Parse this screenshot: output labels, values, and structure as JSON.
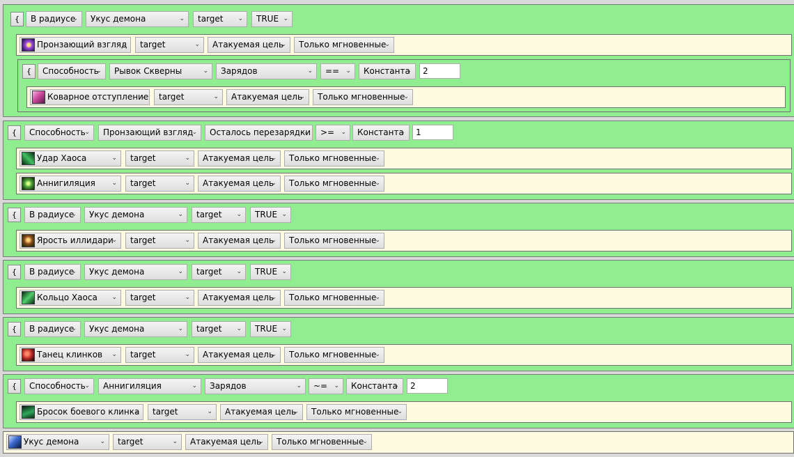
{
  "blocks": [
    {
      "brace": "{",
      "cond": [
        "В радиусе",
        "Укус демона",
        "target",
        "TRUE"
      ],
      "actions": [
        {
          "spell": "Пронзающий взгляд",
          "icon": "eye-beam-icon",
          "target": "target",
          "unit": "Атакуемая цель",
          "mode": "Только мгновенные"
        }
      ],
      "sub": {
        "brace": "{",
        "cond": [
          "Способность",
          "Рывок Скверны",
          "Зарядов",
          "==",
          "Константа"
        ],
        "value": "2",
        "action": {
          "spell": "Коварное отступление",
          "icon": "vengeful-retreat-icon",
          "target": "target",
          "unit": "Атакуемая цель",
          "mode": "Только мгновенные"
        }
      }
    },
    {
      "brace": "{",
      "cond": [
        "Способность",
        "Пронзающий взгляд",
        "Осталось перезарядки",
        ">=",
        "Константа"
      ],
      "value": "1",
      "actions": [
        {
          "spell": "Удар Хаоса",
          "icon": "chaos-strike-icon",
          "target": "target",
          "unit": "Атакуемая цель",
          "mode": "Только мгновенные"
        },
        {
          "spell": "Аннигиляция",
          "icon": "annihilation-icon",
          "target": "target",
          "unit": "Атакуемая цель",
          "mode": "Только мгновенные"
        }
      ]
    },
    {
      "brace": "{",
      "cond": [
        "В радиусе",
        "Укус демона",
        "target",
        "TRUE"
      ],
      "actions": [
        {
          "spell": "Ярость иллидари",
          "icon": "fury-of-the-illidari-icon",
          "target": "target",
          "unit": "Атакуемая цель",
          "mode": "Только мгновенные"
        }
      ]
    },
    {
      "brace": "{",
      "cond": [
        "В радиусе",
        "Укус демона",
        "target",
        "TRUE"
      ],
      "actions": [
        {
          "spell": "Кольцо Хаоса",
          "icon": "chaos-nova-icon",
          "target": "target",
          "unit": "Атакуемая цель",
          "mode": "Только мгновенные"
        }
      ]
    },
    {
      "brace": "{",
      "cond": [
        "В радиусе",
        "Укус демона",
        "target",
        "TRUE"
      ],
      "actions": [
        {
          "spell": "Танец клинков",
          "icon": "blade-dance-icon",
          "target": "target",
          "unit": "Атакуемая цель",
          "mode": "Только мгновенные"
        }
      ]
    },
    {
      "brace": "{",
      "cond": [
        "Способность",
        "Аннигиляция",
        "Зарядов",
        "~=",
        "Константа"
      ],
      "value": "2",
      "actions": [
        {
          "spell": "Бросок боевого клинка",
          "icon": "throw-glaive-icon",
          "target": "target",
          "unit": "Атакуемая цель",
          "mode": "Только мгновенные"
        }
      ]
    }
  ],
  "final_action": {
    "spell": "Укус демона",
    "icon": "demons-bite-icon",
    "target": "target",
    "unit": "Атакуемая цель",
    "mode": "Только мгновенные"
  },
  "arrow": "⌄",
  "colors": {
    "block": "#90ee90",
    "action": "#fffbe0",
    "border": "#6f6f6f"
  },
  "icon_colors": {
    "eye-beam-icon": "#7a3fc0",
    "vengeful-retreat-icon": "#b04a9a",
    "chaos-strike-icon": "#2f8f3f",
    "annihilation-icon": "#3f8a2a",
    "fury-of-the-illidari-icon": "#8a5a1f",
    "chaos-nova-icon": "#2a8a4a",
    "blade-dance-icon": "#b02a2a",
    "throw-glaive-icon": "#1f7a4a",
    "demons-bite-icon": "#2a4fa0"
  }
}
